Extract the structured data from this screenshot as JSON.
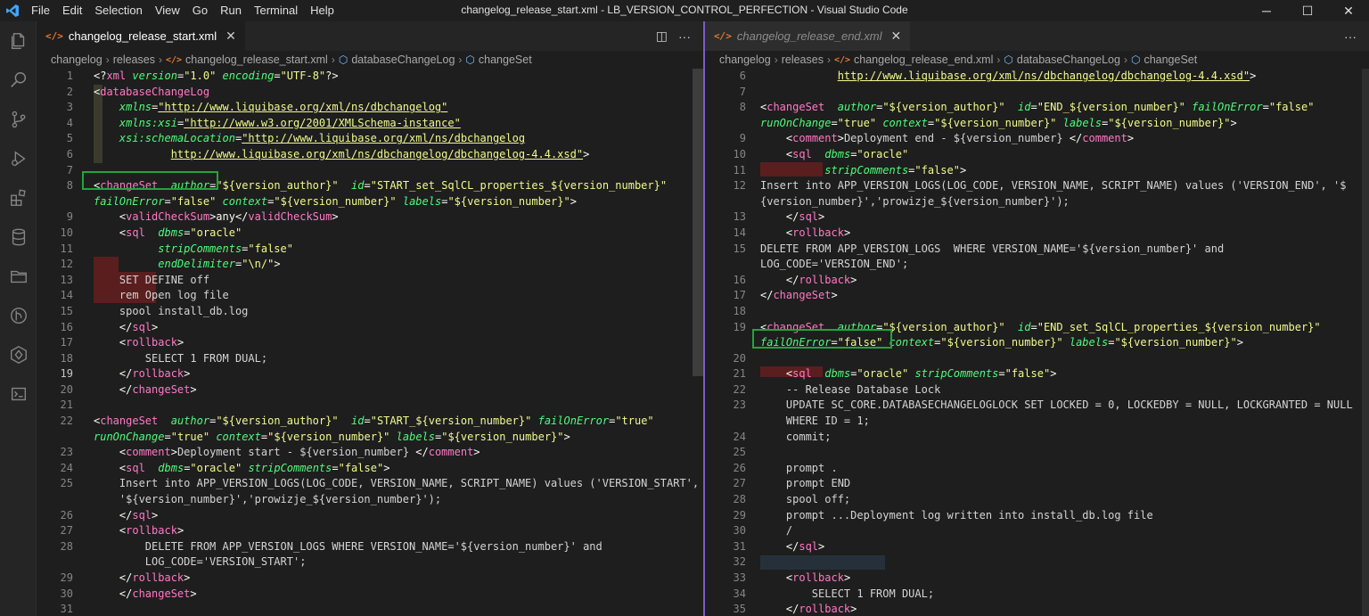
{
  "app": {
    "window_title": "changelog_release_start.xml - LB_VERSION_CONTROL_PERFECTION - Visual Studio Code",
    "menu": [
      "File",
      "Edit",
      "Selection",
      "View",
      "Go",
      "Run",
      "Terminal",
      "Help"
    ],
    "window_controls": {
      "minimize": "─",
      "maximize": "☐",
      "close": "✕"
    }
  },
  "activity_bar": {
    "icons": [
      "explorer-icon",
      "search-icon",
      "source-control-icon",
      "run-debug-icon",
      "extensions-icon",
      "database-icon",
      "folder-icon",
      "git-graph-icon",
      "liquibase-icon",
      "terminal-icon"
    ]
  },
  "left_editor": {
    "tab": {
      "label": "changelog_release_start.xml",
      "icon": "</>",
      "close": "✕"
    },
    "breadcrumb": [
      "changelog",
      "releases",
      "changelog_release_start.xml",
      "databaseChangeLog",
      "changeSet"
    ],
    "lines": [
      {
        "n": "1",
        "html": "<span class='p'>&lt;?</span><span class='t'>xml</span> <span class='a'>version</span><span class='p'>=</span><span class='s'>\"1.0\"</span> <span class='a'>encoding</span><span class='p'>=</span><span class='s'>\"UTF-8\"</span><span class='p'>?&gt;</span>"
      },
      {
        "n": "2",
        "html": "<span class='p'>&lt;</span><span class='t'>databaseChangeLog</span>"
      },
      {
        "n": "3",
        "html": "    <span class='a'>xmlns</span><span class='p'>=</span><span class='s u'>\"http://www.liquibase.org/xml/ns/dbchangelog\"</span>"
      },
      {
        "n": "4",
        "html": "    <span class='a'>xmlns:xsi</span><span class='p'>=</span><span class='s u'>\"http://www.w3.org/2001/XMLSchema-instance\"</span>"
      },
      {
        "n": "5",
        "html": "    <span class='a'>xsi:schemaLocation</span><span class='p'>=</span><span class='s u'>\"http://www.liquibase.org/xml/ns/dbchangelog</span>"
      },
      {
        "n": "6",
        "html": "            <span class='s u'>http://www.liquibase.org/xml/ns/dbchangelog/dbchangelog-4.4.xsd\"</span><span class='p'>&gt;</span>"
      },
      {
        "n": "7",
        "html": ""
      },
      {
        "n": "8",
        "html": "<span class='p'>&lt;</span><span class='t'>changeSet</span>  <span class='a'>author</span><span class='p'>=</span><span class='s'>\"${version_author}\"</span>  <span class='a'>id</span><span class='p'>=</span><span class='s'>\"START_set_SqlCL_properties_${version_number}\"</span>"
      },
      {
        "n": "",
        "html": "<span class='a'>failOnError</span><span class='p'>=</span><span class='s'>\"false\"</span> <span class='a'>context</span><span class='p'>=</span><span class='s'>\"${version_number}\"</span> <span class='a'>labels</span><span class='p'>=</span><span class='s'>\"${version_number}\"</span><span class='p'>&gt;</span>"
      },
      {
        "n": "9",
        "html": "    <span class='p'>&lt;</span><span class='t'>validCheckSum</span><span class='p'>&gt;any&lt;/</span><span class='t'>validCheckSum</span><span class='p'>&gt;</span>"
      },
      {
        "n": "10",
        "html": "    <span class='p'>&lt;</span><span class='t'>sql</span>  <span class='a'>dbms</span><span class='p'>=</span><span class='s'>\"oracle\"</span>"
      },
      {
        "n": "11",
        "html": "          <span class='a'>stripComments</span><span class='p'>=</span><span class='s'>\"false\"</span>"
      },
      {
        "n": "12",
        "html": "          <span class='a'>endDelimiter</span><span class='p'>=</span><span class='s'>\"\\n/\"</span><span class='p'>&gt;</span>"
      },
      {
        "n": "13",
        "html": "    SET DEFINE off"
      },
      {
        "n": "14",
        "html": "    rem Open log file"
      },
      {
        "n": "15",
        "html": "    spool install_db.log"
      },
      {
        "n": "16",
        "html": "    <span class='p'>&lt;/</span><span class='t'>sql</span><span class='p'>&gt;</span>"
      },
      {
        "n": "17",
        "html": "    <span class='p'>&lt;</span><span class='t'>rollback</span><span class='p'>&gt;</span>"
      },
      {
        "n": "18",
        "html": "        SELECT 1 FROM DUAL;"
      },
      {
        "n": "19",
        "html": "    <span class='p'>&lt;/</span><span class='t'>rollback</span><span class='p'>&gt;</span>"
      },
      {
        "n": "20",
        "html": "    <span class='p'>&lt;/</span><span class='t'>changeSet</span><span class='p'>&gt;</span>"
      },
      {
        "n": "21",
        "html": ""
      },
      {
        "n": "22",
        "html": "<span class='p'>&lt;</span><span class='t'>changeSet</span>  <span class='a'>author</span><span class='p'>=</span><span class='s'>\"${version_author}\"</span>  <span class='a'>id</span><span class='p'>=</span><span class='s'>\"START_${version_number}\"</span> <span class='a'>failOnError</span><span class='p'>=</span><span class='s'>\"true\"</span>"
      },
      {
        "n": "",
        "html": "<span class='a'>runOnChange</span><span class='p'>=</span><span class='s'>\"true\"</span> <span class='a'>context</span><span class='p'>=</span><span class='s'>\"${version_number}\"</span> <span class='a'>labels</span><span class='p'>=</span><span class='s'>\"${version_number}\"</span><span class='p'>&gt;</span>"
      },
      {
        "n": "23",
        "html": "    <span class='p'>&lt;</span><span class='t'>comment</span><span class='p'>&gt;</span>Deployment start - ${version_number} <span class='p'>&lt;/</span><span class='t'>comment</span><span class='p'>&gt;</span>"
      },
      {
        "n": "24",
        "html": "    <span class='p'>&lt;</span><span class='t'>sql</span>  <span class='a'>dbms</span><span class='p'>=</span><span class='s'>\"oracle\"</span> <span class='a'>stripComments</span><span class='p'>=</span><span class='s'>\"false\"</span><span class='p'>&gt;</span>"
      },
      {
        "n": "25",
        "html": "    Insert into APP_VERSION_LOGS(LOG_CODE, VERSION_NAME, SCRIPT_NAME) values ('VERSION_START',"
      },
      {
        "n": "",
        "html": "    '${version_number}','prowizje_${version_number}');"
      },
      {
        "n": "26",
        "html": "    <span class='p'>&lt;/</span><span class='t'>sql</span><span class='p'>&gt;</span>"
      },
      {
        "n": "27",
        "html": "    <span class='p'>&lt;</span><span class='t'>rollback</span><span class='p'>&gt;</span>"
      },
      {
        "n": "28",
        "html": "        DELETE FROM APP_VERSION_LOGS WHERE VERSION_NAME='${version_number}' and"
      },
      {
        "n": "",
        "html": "        LOG_CODE='VERSION_START';"
      },
      {
        "n": "29",
        "html": "    <span class='p'>&lt;/</span><span class='t'>rollback</span><span class='p'>&gt;</span>"
      },
      {
        "n": "30",
        "html": "    <span class='p'>&lt;/</span><span class='t'>changeSet</span><span class='p'>&gt;</span>"
      },
      {
        "n": "31",
        "html": ""
      }
    ],
    "current_line": "19"
  },
  "right_editor": {
    "tab": {
      "label": "changelog_release_end.xml",
      "icon": "</>",
      "close": "✕"
    },
    "breadcrumb": [
      "changelog",
      "releases",
      "changelog_release_end.xml",
      "databaseChangeLog",
      "changeSet"
    ],
    "lines": [
      {
        "n": "6",
        "html": "            <span class='s u'>http://www.liquibase.org/xml/ns/dbchangelog/dbchangelog-4.4.xsd\"</span><span class='p'>&gt;</span>"
      },
      {
        "n": "7",
        "html": ""
      },
      {
        "n": "8",
        "html": "<span class='p'>&lt;</span><span class='t'>changeSet</span>  <span class='a'>author</span><span class='p'>=</span><span class='s'>\"${version_author}\"</span>  <span class='a'>id</span><span class='p'>=</span><span class='s'>\"END_${version_number}\"</span> <span class='a'>failOnError</span><span class='p'>=</span><span class='s'>\"false\"</span>"
      },
      {
        "n": "",
        "html": "<span class='a'>runOnChange</span><span class='p'>=</span><span class='s'>\"true\"</span> <span class='a'>context</span><span class='p'>=</span><span class='s'>\"${version_number}\"</span> <span class='a'>labels</span><span class='p'>=</span><span class='s'>\"${version_number}\"</span><span class='p'>&gt;</span>"
      },
      {
        "n": "9",
        "html": "    <span class='p'>&lt;</span><span class='t'>comment</span><span class='p'>&gt;</span>Deployment end - ${version_number} <span class='p'>&lt;/</span><span class='t'>comment</span><span class='p'>&gt;</span>"
      },
      {
        "n": "10",
        "html": "    <span class='p'>&lt;</span><span class='t'>sql</span>  <span class='a'>dbms</span><span class='p'>=</span><span class='s'>\"oracle\"</span>"
      },
      {
        "n": "11",
        "html": "          <span class='a'>stripComments</span><span class='p'>=</span><span class='s'>\"false\"</span><span class='p'>&gt;</span>"
      },
      {
        "n": "12",
        "html": "Insert into APP_VERSION_LOGS(LOG_CODE, VERSION_NAME, SCRIPT_NAME) values ('VERSION_END', '$"
      },
      {
        "n": "",
        "html": "{version_number}','prowizje_${version_number}');"
      },
      {
        "n": "13",
        "html": "    <span class='p'>&lt;/</span><span class='t'>sql</span><span class='p'>&gt;</span>"
      },
      {
        "n": "14",
        "html": "    <span class='p'>&lt;</span><span class='t'>rollback</span><span class='p'>&gt;</span>"
      },
      {
        "n": "15",
        "html": "DELETE FROM APP_VERSION_LOGS  WHERE VERSION_NAME='${version_number}' and"
      },
      {
        "n": "",
        "html": "LOG_CODE='VERSION_END';"
      },
      {
        "n": "16",
        "html": "    <span class='p'>&lt;/</span><span class='t'>rollback</span><span class='p'>&gt;</span>"
      },
      {
        "n": "17",
        "html": "<span class='p'>&lt;/</span><span class='t'>changeSet</span><span class='p'>&gt;</span>"
      },
      {
        "n": "18",
        "html": ""
      },
      {
        "n": "19",
        "html": "<span class='p'>&lt;</span><span class='t'>changeSet</span>  <span class='a'>author</span><span class='p'>=</span><span class='s'>\"${version_author}\"</span>  <span class='a'>id</span><span class='p'>=</span><span class='s'>\"END_set_SqlCL_properties_${version_number}\"</span>"
      },
      {
        "n": "",
        "html": "<span class='a'>failOnError</span><span class='p'>=</span><span class='s'>\"false\"</span> <span class='a'>context</span><span class='p'>=</span><span class='s'>\"${version_number}\"</span> <span class='a'>labels</span><span class='p'>=</span><span class='s'>\"${version_number}\"</span><span class='p'>&gt;</span>"
      },
      {
        "n": "20",
        "html": ""
      },
      {
        "n": "21",
        "html": "    <span class='p'>&lt;</span><span class='t'>sql</span>  <span class='a'>dbms</span><span class='p'>=</span><span class='s'>\"oracle\"</span> <span class='a'>stripComments</span><span class='p'>=</span><span class='s'>\"false\"</span><span class='p'>&gt;</span>"
      },
      {
        "n": "22",
        "html": "    -- Release Database Lock"
      },
      {
        "n": "23",
        "html": "    UPDATE SC_CORE.DATABASECHANGELOGLOCK SET LOCKED = 0, LOCKEDBY = NULL, LOCKGRANTED = NULL"
      },
      {
        "n": "",
        "html": "    WHERE ID = 1;"
      },
      {
        "n": "24",
        "html": "    commit;"
      },
      {
        "n": "25",
        "html": ""
      },
      {
        "n": "26",
        "html": "    prompt ."
      },
      {
        "n": "27",
        "html": "    prompt END"
      },
      {
        "n": "28",
        "html": "    spool off;"
      },
      {
        "n": "29",
        "html": "    prompt ...Deployment log written into install_db.log file"
      },
      {
        "n": "30",
        "html": "    /"
      },
      {
        "n": "31",
        "html": "    <span class='p'>&lt;/</span><span class='t'>sql</span><span class='p'>&gt;</span>"
      },
      {
        "n": "32",
        "html": ""
      },
      {
        "n": "33",
        "html": "    <span class='p'>&lt;</span><span class='t'>rollback</span><span class='p'>&gt;</span>"
      },
      {
        "n": "34",
        "html": "        SELECT 1 FROM DUAL;"
      },
      {
        "n": "35",
        "html": "    <span class='p'>&lt;/</span><span class='t'>rollback</span><span class='p'>&gt;</span>"
      }
    ]
  }
}
